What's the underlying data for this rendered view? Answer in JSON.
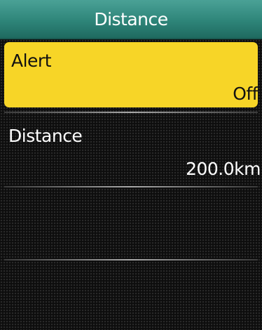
{
  "header": {
    "title": "Distance"
  },
  "menu": {
    "items": [
      {
        "label": "Alert",
        "value": "Off",
        "selected": true
      },
      {
        "label": "Distance",
        "value": "200.0km",
        "selected": false
      }
    ]
  },
  "colors": {
    "header_teal": "#2e8579",
    "selection_yellow": "#f7d527",
    "background": "#0d0d0d",
    "text_light": "#ffffff",
    "text_dark": "#111111"
  }
}
